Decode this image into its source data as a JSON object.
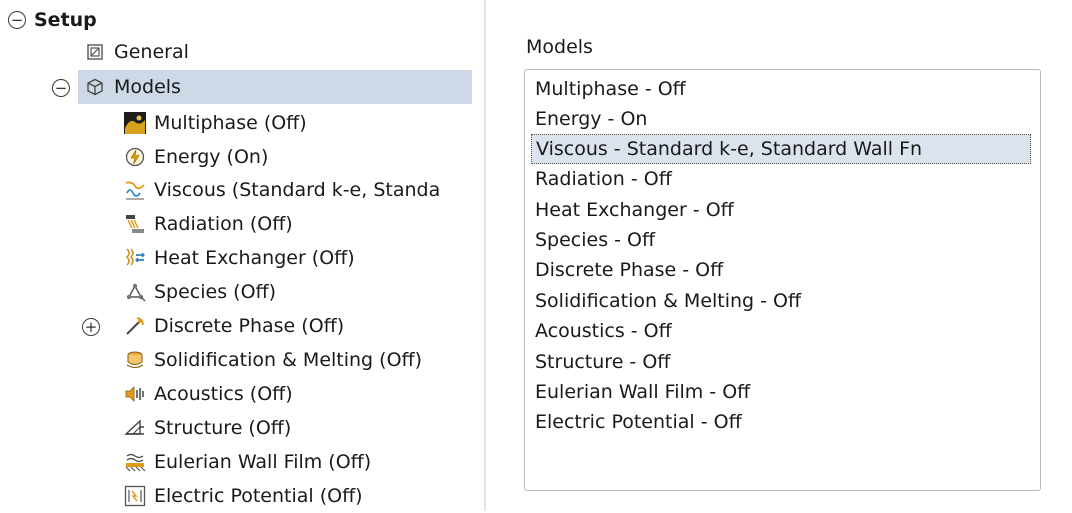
{
  "tree": {
    "setup_label": "Setup",
    "general_label": "General",
    "models_label": "Models",
    "children": [
      {
        "label": "Multiphase (Off)",
        "icon": "multiphase-icon"
      },
      {
        "label": "Energy (On)",
        "icon": "energy-icon"
      },
      {
        "label": "Viscous (Standard k-e, Standa",
        "icon": "viscous-icon"
      },
      {
        "label": "Radiation (Off)",
        "icon": "radiation-icon"
      },
      {
        "label": "Heat Exchanger (Off)",
        "icon": "heat-exchanger-icon"
      },
      {
        "label": "Species (Off)",
        "icon": "species-icon"
      },
      {
        "label": "Discrete Phase (Off)",
        "icon": "discrete-phase-icon"
      },
      {
        "label": "Solidification & Melting (Off)",
        "icon": "solidification-icon"
      },
      {
        "label": "Acoustics (Off)",
        "icon": "acoustics-icon"
      },
      {
        "label": "Structure (Off)",
        "icon": "structure-icon"
      },
      {
        "label": "Eulerian Wall Film (Off)",
        "icon": "eulerian-wall-film-icon"
      },
      {
        "label": "Electric Potential (Off)",
        "icon": "electric-potential-icon"
      }
    ]
  },
  "models_panel": {
    "title": "Models",
    "selected_index": 2,
    "items": [
      "Multiphase - Off",
      "Energy - On",
      "Viscous - Standard k-e, Standard Wall Fn",
      "Radiation - Off",
      "Heat Exchanger - Off",
      "Species - Off",
      "Discrete Phase - Off",
      "Solidification & Melting - Off",
      "Acoustics - Off",
      "Structure - Off",
      "Eulerian Wall Film - Off",
      "Electric Potential - Off"
    ]
  }
}
